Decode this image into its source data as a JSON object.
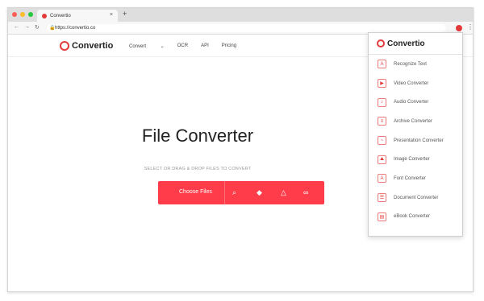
{
  "browser": {
    "tab_title": "Convertio",
    "tab_close": "×",
    "new_tab": "+",
    "url": "https://convertio.co",
    "menu": "⋮"
  },
  "header": {
    "logo": "Convertio",
    "nav": [
      "Convert",
      "OCR",
      "API",
      "Pricing"
    ]
  },
  "main": {
    "title": "File Converter",
    "subtitle": "SELECT OR DRAG & DROP FILES TO CONVERT",
    "choose_label": "Choose Files"
  },
  "dropdown": {
    "title": "Convertio",
    "items": [
      {
        "label": "Recognize Text",
        "icon": "recognize-text-icon"
      },
      {
        "label": "Video Converter",
        "icon": "video-icon"
      },
      {
        "label": "Audio Converter",
        "icon": "audio-icon"
      },
      {
        "label": "Archive Converter",
        "icon": "archive-icon"
      },
      {
        "label": "Presentation Converter",
        "icon": "presentation-icon"
      },
      {
        "label": "Image Converter",
        "icon": "image-icon"
      },
      {
        "label": "Font Converter",
        "icon": "font-icon"
      },
      {
        "label": "Document Converter",
        "icon": "document-icon"
      },
      {
        "label": "eBook Converter",
        "icon": "ebook-icon"
      }
    ]
  },
  "colors": {
    "accent": "#ff3d4a",
    "brand": "#e23a3a"
  }
}
